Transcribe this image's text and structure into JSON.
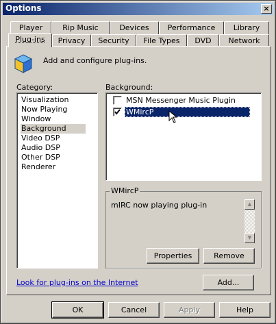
{
  "window": {
    "title": "Options",
    "close_glyph": "×"
  },
  "tabs_row_back": [
    "Player",
    "Rip Music",
    "Devices",
    "Performance",
    "Library"
  ],
  "tabs_row_front": [
    "Plug-ins",
    "Privacy",
    "Security",
    "File Types",
    "DVD",
    "Network"
  ],
  "header": {
    "description": "Add and configure plug-ins.",
    "icon": "plugin-cube-icon"
  },
  "category": {
    "label": "Category:",
    "items": [
      "Visualization",
      "Now Playing",
      "Window",
      "Background",
      "Video DSP",
      "Audio DSP",
      "Other DSP",
      "Renderer"
    ],
    "selected": "Background"
  },
  "background": {
    "label": "Background:",
    "items": [
      {
        "label": "MSN Messenger Music Plugin",
        "checked": false
      },
      {
        "label": "WMircP",
        "checked": true
      }
    ],
    "selected": "WMircP"
  },
  "details": {
    "title": "WMircP",
    "description": "mIRC now playing plug-in",
    "properties_label": "Properties",
    "remove_label": "Remove"
  },
  "footer": {
    "link_text": "Look for plug-ins on the Internet",
    "add_label": "Add..."
  },
  "buttons": {
    "ok": "OK",
    "cancel": "Cancel",
    "apply": "Apply",
    "help": "Help"
  },
  "colors": {
    "title_start": "#0a246a",
    "title_end": "#a6caf0",
    "selection": "#0a246a",
    "link": "#0000cc",
    "face": "#d4d0c8"
  }
}
